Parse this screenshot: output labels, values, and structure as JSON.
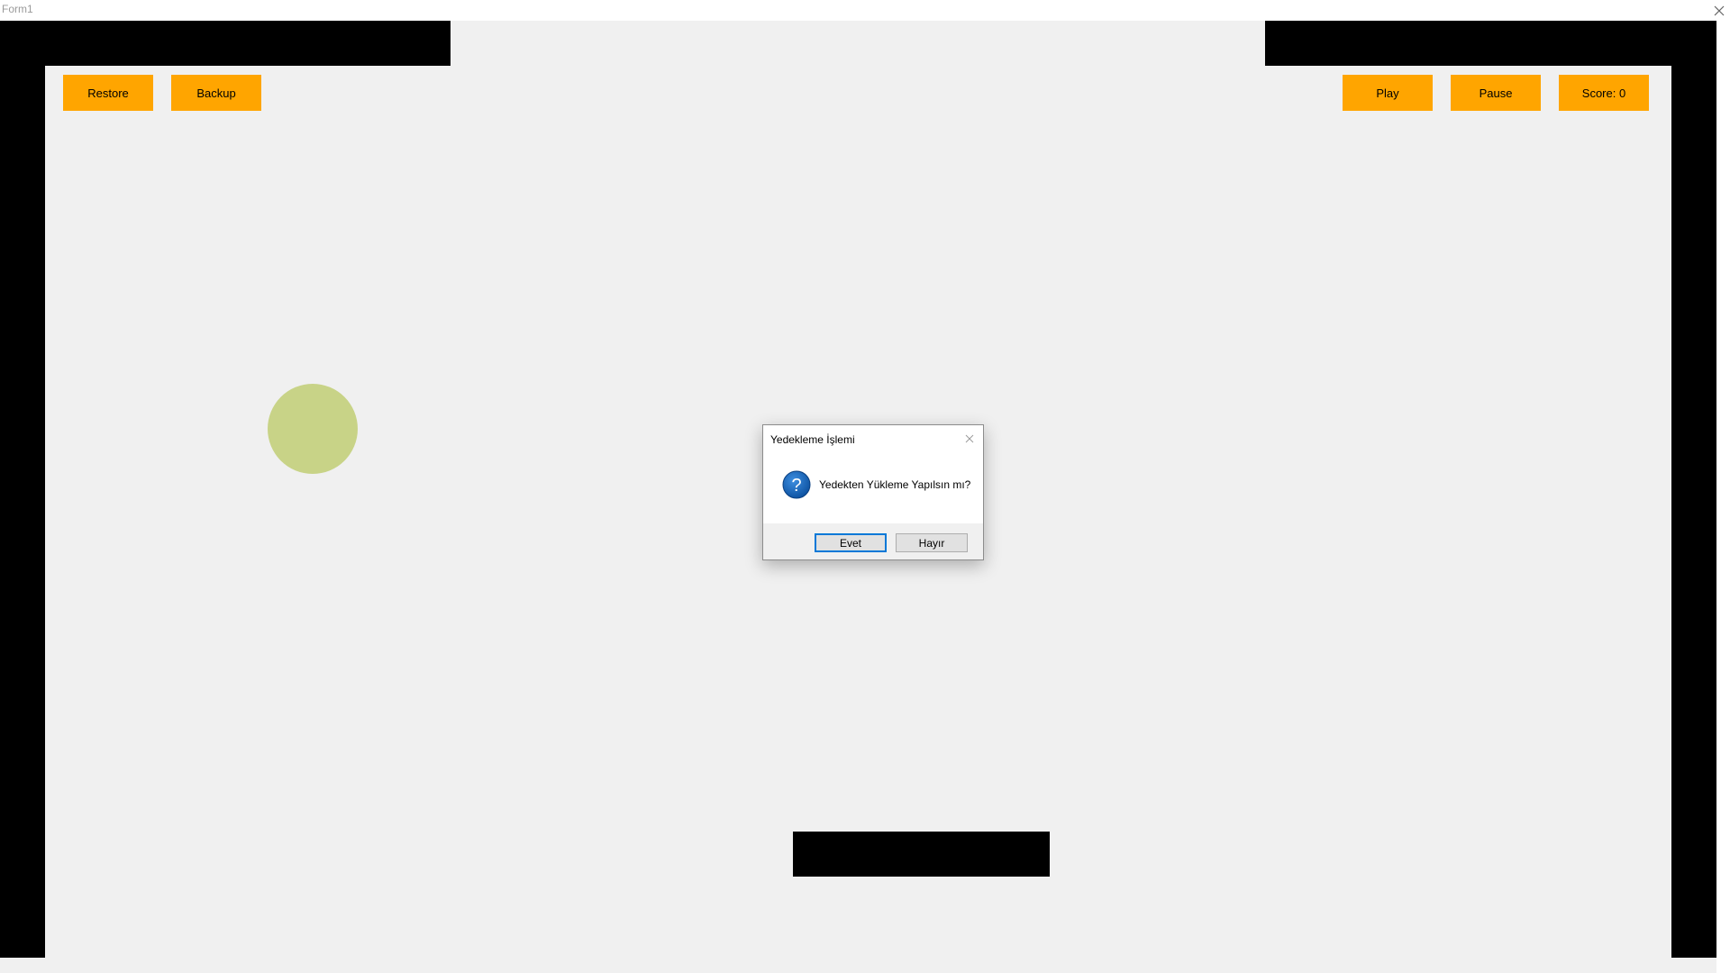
{
  "window": {
    "title": "Form1",
    "close_glyph": "✕"
  },
  "toolbar": {
    "restore_label": "Restore",
    "backup_label": "Backup",
    "play_label": "Play",
    "pause_label": "Pause",
    "score_label": "Score: 0"
  },
  "game": {
    "ball_color": "#c8d387",
    "accent_color": "#ffa500",
    "wall_color": "#000000"
  },
  "dialog": {
    "title": "Yedekleme İşlemi",
    "message": "Yedekten Yükleme Yapılsın mı?",
    "icon": "question-icon",
    "yes_label": "Evet",
    "no_label": "Hayır"
  }
}
